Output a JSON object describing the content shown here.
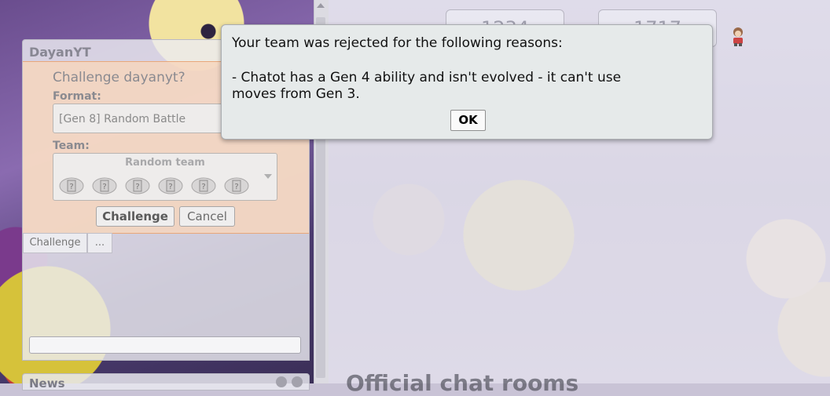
{
  "background": {
    "stats": [
      "1234",
      "1717"
    ],
    "section_title": "Official chat rooms"
  },
  "chat_window": {
    "title": "DayanYT",
    "challenge": {
      "prompt": "Challenge dayanyt?",
      "format_label": "Format:",
      "format_value": "[Gen 8] Random Battle",
      "team_label": "Team:",
      "team_value": "Random team",
      "challenge_button": "Challenge",
      "cancel_button": "Cancel"
    },
    "tabs": [
      "Challenge",
      "..."
    ],
    "input_value": ""
  },
  "news": {
    "title": "News"
  },
  "dialog": {
    "line1": "Your team was rejected for the following reasons:",
    "line2": "- Chatot has a Gen 4 ability and isn't evolved - it can't use",
    "line3": "moves from Gen 3.",
    "ok_button": "OK"
  },
  "colors": {
    "challenge_bg": "#f7d6bc",
    "dialog_bg": "#e6eaea"
  }
}
